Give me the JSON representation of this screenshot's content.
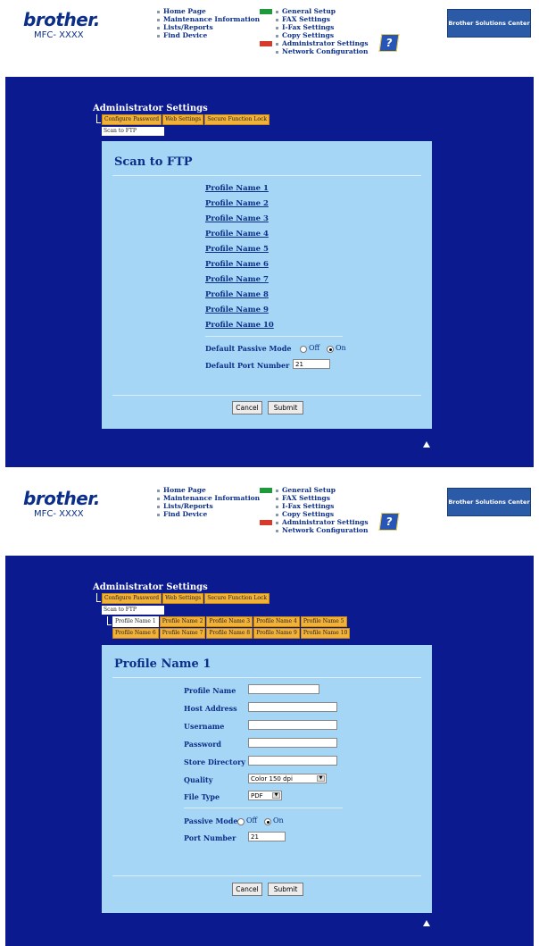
{
  "header": {
    "logo_word": "brother.",
    "model": "MFC- XXXX",
    "menu_left": [
      "Home Page",
      "Maintenance Information",
      "Lists/Reports",
      "Find Device"
    ],
    "menu_right": [
      "General Setup",
      "FAX Settings",
      "I-Fax Settings",
      "Copy Settings",
      "Administrator Settings",
      "Network Configuration"
    ],
    "help_icon": "question-book-icon",
    "help_glyph": "?",
    "solutions_center": "Brother Solutions Center"
  },
  "admin": {
    "title": "Administrator Settings",
    "tabs": [
      "Configure Password",
      "Web Settings",
      "Secure Function Lock"
    ],
    "sub_tab": "Scan to FTP"
  },
  "scan_ftp": {
    "title": "Scan to FTP",
    "profiles": [
      "Profile Name 1",
      "Profile Name 2",
      "Profile Name 3",
      "Profile Name 4",
      "Profile Name 5",
      "Profile Name 6",
      "Profile Name 7",
      "Profile Name 8",
      "Profile Name 9",
      "Profile Name 10"
    ],
    "passive_label": "Default Passive Mode",
    "off": "Off",
    "on": "On",
    "passive_selected": "On",
    "port_label": "Default Port Number",
    "port_value": "21",
    "cancel": "Cancel",
    "submit": "Submit"
  },
  "profile": {
    "title": "Profile Name 1",
    "profile_tabs": [
      "Profile Name 1",
      "Profile Name 2",
      "Profile Name 3",
      "Profile Name 4",
      "Profile Name 5",
      "Profile Name 6",
      "Profile Name 7",
      "Profile Name 8",
      "Profile Name 9",
      "Profile Name 10"
    ],
    "fields": {
      "profile_name": "Profile Name",
      "host_address": "Host Address",
      "username": "Username",
      "password": "Password",
      "store_directory": "Store Directory",
      "quality": "Quality",
      "file_type": "File Type",
      "passive_mode": "Passive Mode",
      "port_number": "Port Number"
    },
    "values": {
      "profile_name": "",
      "host_address": "",
      "username": "",
      "password": "",
      "store_directory": "",
      "quality": "Color 150 dpi",
      "file_type": "PDF",
      "port_number": "21"
    },
    "off": "Off",
    "on": "On",
    "passive_selected": "On",
    "cancel": "Cancel",
    "submit": "Submit"
  },
  "colors": {
    "main_bg": "#0b1b8f",
    "panel_bg": "#a6d6f5",
    "tab_bg": "#f2b23a",
    "link": "#0b2e88"
  }
}
